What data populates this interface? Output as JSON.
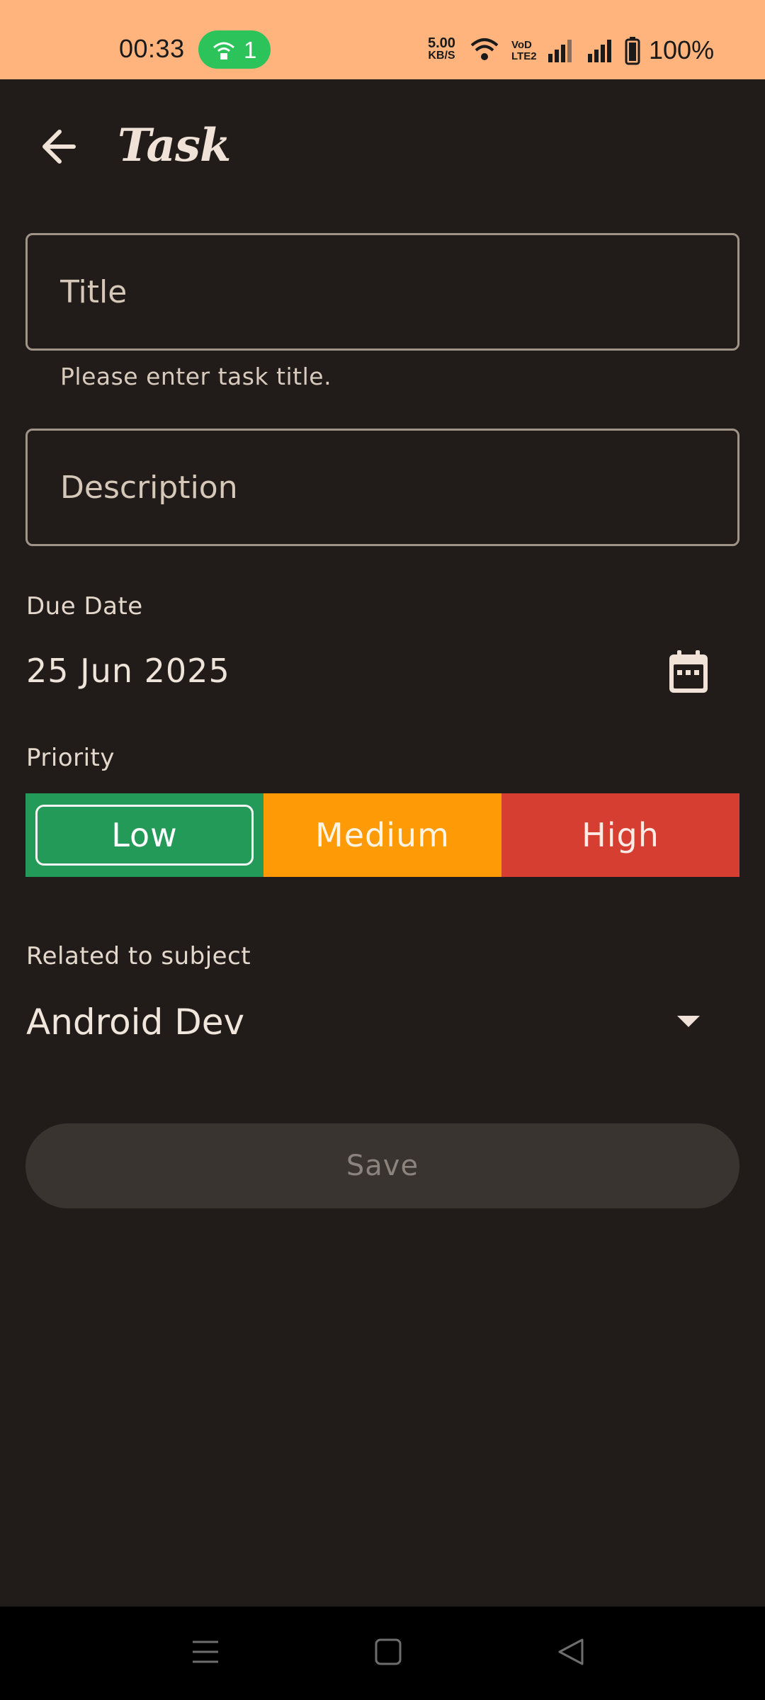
{
  "status_bar": {
    "time": "00:33",
    "hotspot_count": "1",
    "speed_value": "5.00",
    "speed_unit": "KB/S",
    "volte_label": "VoD LTE2",
    "battery_percent": "100%"
  },
  "app_bar": {
    "title": "Task",
    "back_icon": "arrow-back-icon"
  },
  "form": {
    "title_placeholder": "Title",
    "title_helper": "Please enter task title.",
    "description_placeholder": "Description",
    "due_date_label": "Due Date",
    "due_date_value": "25 Jun 2025",
    "priority_label": "Priority",
    "priority_options": [
      "Low",
      "Medium",
      "High"
    ],
    "priority_selected": "Low",
    "subject_label": "Related to subject",
    "subject_value": "Android Dev",
    "save_label": "Save"
  },
  "colors": {
    "background": "#211c19",
    "status_bar": "#ffb47e",
    "priority_low": "#249a59",
    "priority_medium": "#ff9a07",
    "priority_high": "#d63e32"
  }
}
